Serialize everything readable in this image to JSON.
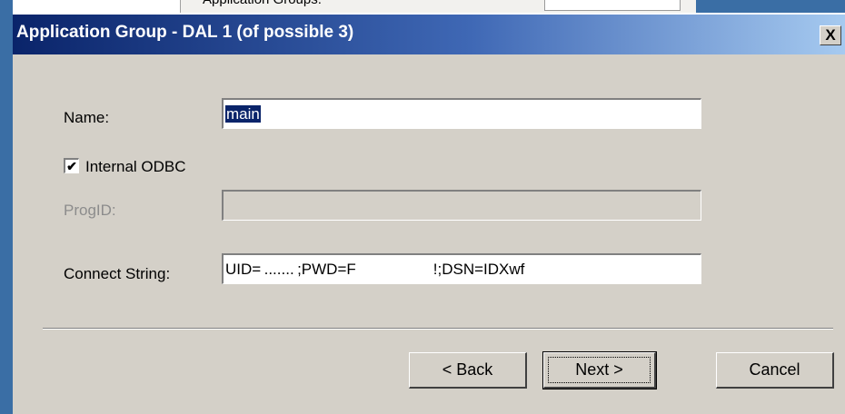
{
  "background": {
    "window_text": "Application Groups:"
  },
  "dialog": {
    "title": "Application Group - DAL 1 (of possible 3)",
    "close_label": "X"
  },
  "form": {
    "name_label": "Name:",
    "name_value": "main",
    "internal_odbc_label": "Internal ODBC",
    "internal_odbc_checked": "✔",
    "progid_label": "ProgID:",
    "progid_value": "",
    "connect_label": "Connect String:",
    "connect_value": "UID= ....... ;PWD=F     !;DSN=IDXwf"
  },
  "buttons": {
    "back": "< Back",
    "next": "Next >",
    "cancel": "Cancel"
  },
  "colors": {
    "title_gradient_start": "#0a246a",
    "title_gradient_end": "#a6caf0",
    "dialog_face": "#d4d0c8",
    "selection": "#0a246a"
  }
}
